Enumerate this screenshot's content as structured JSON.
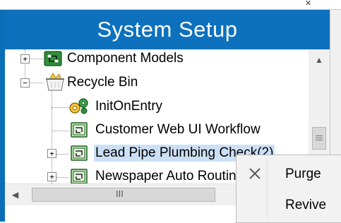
{
  "header": {
    "title": "System Setup"
  },
  "tree": {
    "rows": [
      {
        "label": "Component Models",
        "icon": "component-models-icon",
        "expander": "+"
      },
      {
        "label": "Recycle Bin",
        "icon": "recycle-bin-icon",
        "expander": "−"
      },
      {
        "label": "InitOnEntry",
        "icon": "init-on-entry-icon"
      },
      {
        "label": "Customer Web UI Workflow",
        "icon": "workflow-icon"
      },
      {
        "label": "Lead Pipe Plumbing Check(2)",
        "icon": "workflow-icon",
        "expander": "+",
        "selected": true
      },
      {
        "label": "Newspaper Auto Routing",
        "icon": "workflow-icon",
        "expander": "+"
      }
    ]
  },
  "scroll": {
    "hgrip": "III"
  },
  "context_menu": {
    "items": [
      {
        "label": "Purge",
        "icon": "close-icon"
      },
      {
        "label": "Revive"
      }
    ]
  },
  "colors": {
    "header_bg": "#0d71bd",
    "selection_bg": "#cce0f5"
  }
}
